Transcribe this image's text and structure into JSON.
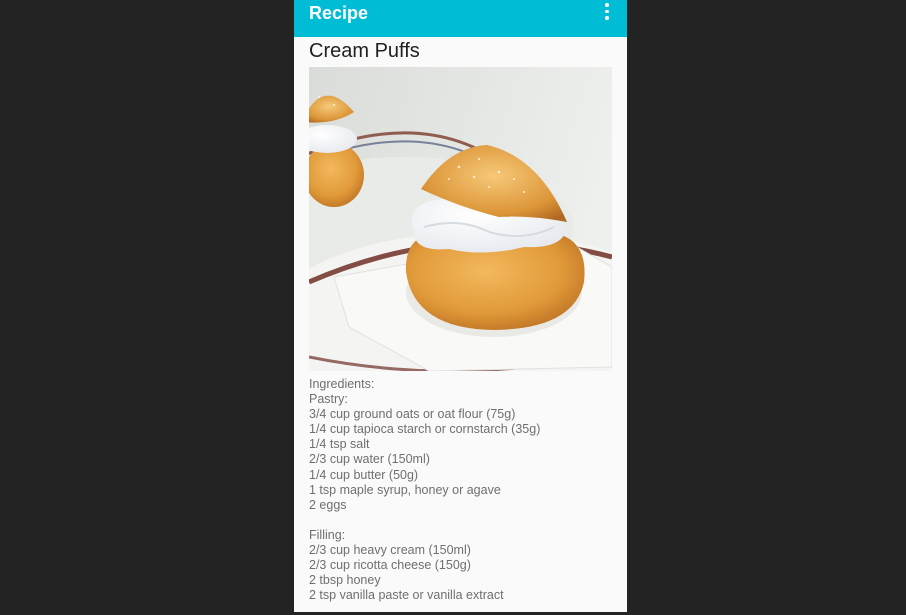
{
  "app_bar": {
    "title": "Recipe",
    "overflow_icon": "more-vert-icon",
    "color": "#00bcd4"
  },
  "recipe": {
    "title": "Cream Puffs",
    "photo": "cream-puff-photo",
    "ingredients_heading": "Ingredients:",
    "pastry_heading": "Pastry:",
    "pastry": [
      "3/4 cup ground oats or oat flour (75g)",
      "1/4 cup tapioca starch or cornstarch (35g)",
      "1/4 tsp salt",
      "2/3 cup water (150ml)",
      "1/4 cup butter (50g)",
      "1 tsp maple syrup, honey or agave",
      "2 eggs"
    ],
    "filling_heading": "Filling:",
    "filling": [
      "2/3 cup heavy cream (150ml)",
      "2/3 cup ricotta cheese (150g)",
      "2 tbsp honey",
      "2 tsp vanilla paste or vanilla extract"
    ]
  }
}
